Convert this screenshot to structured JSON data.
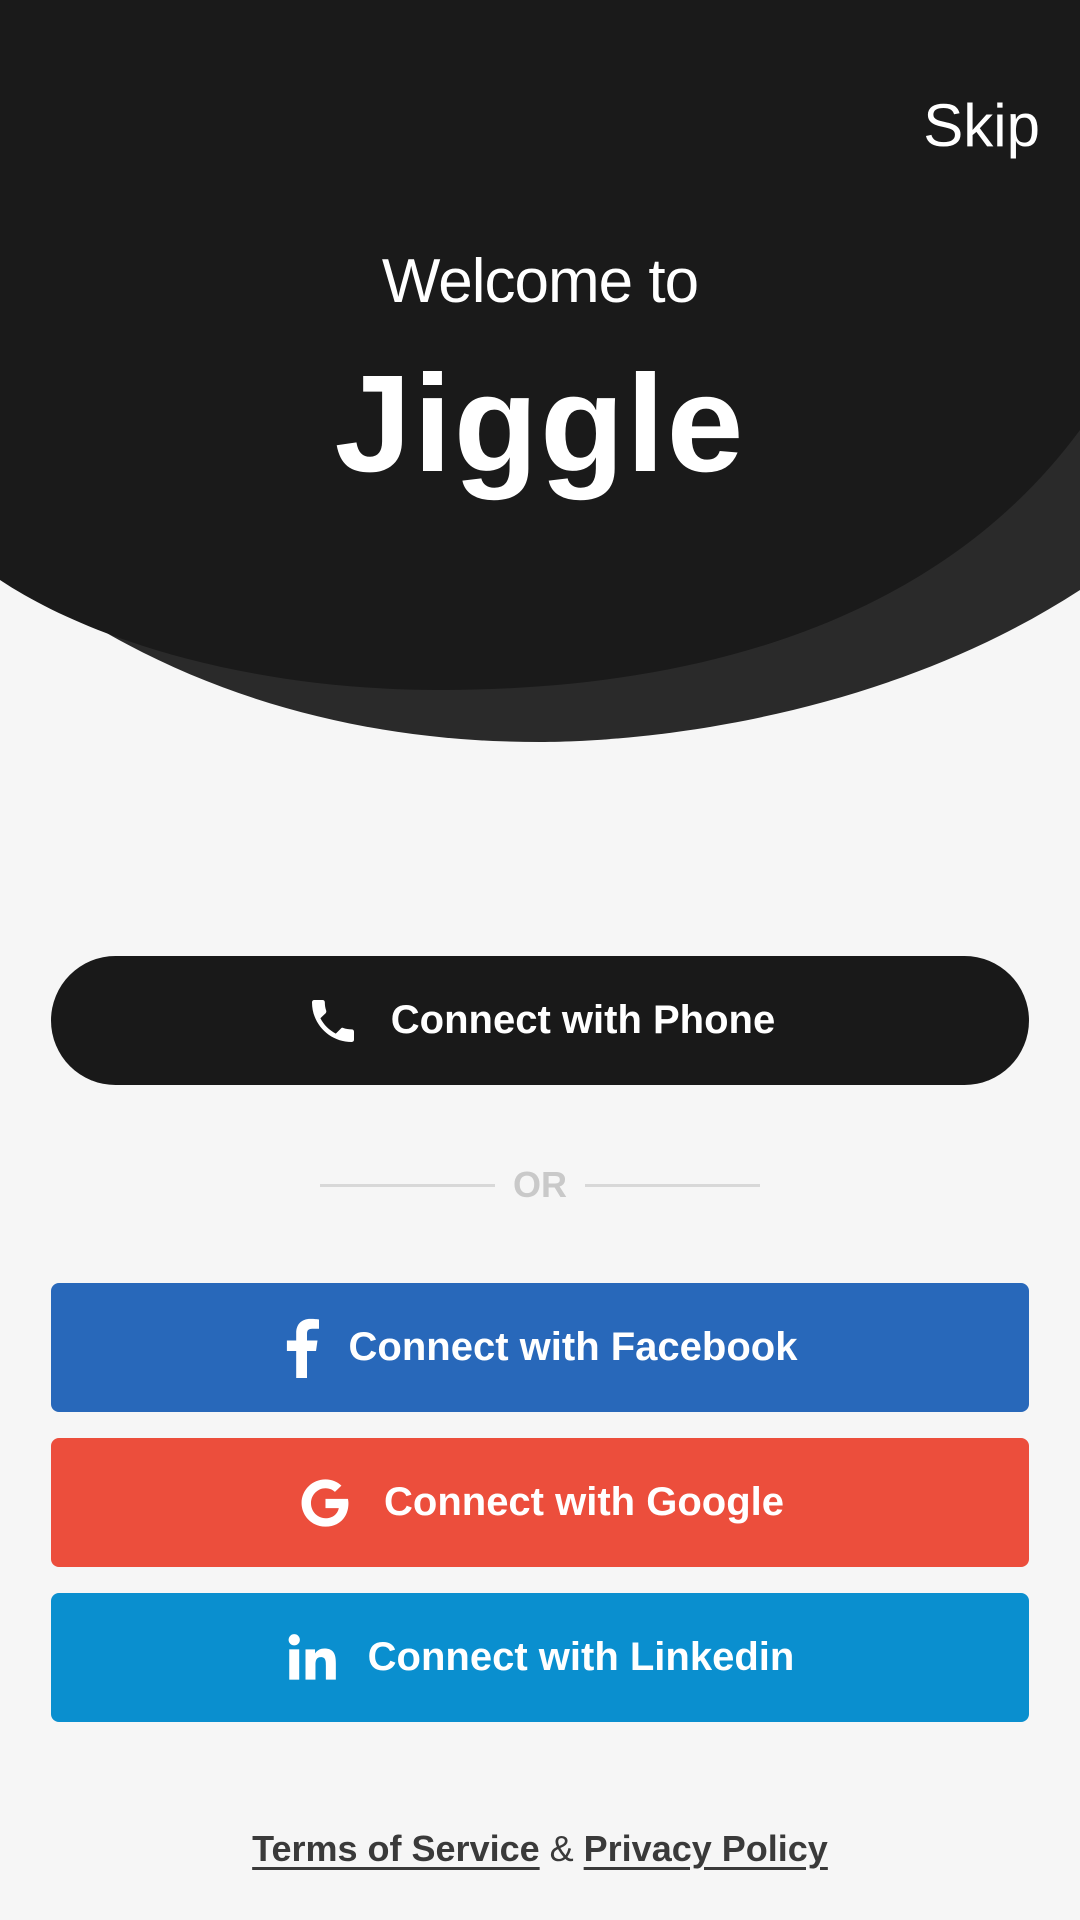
{
  "header": {
    "skip_label": "Skip",
    "welcome_text": "Welcome to",
    "brand_name": "Jiggle"
  },
  "buttons": {
    "phone": {
      "label": "Connect with Phone",
      "icon": "phone-icon",
      "color": "#191919"
    },
    "or_label": "OR",
    "facebook": {
      "label": "Connect with Facebook",
      "icon": "facebook-icon",
      "color": "#2868ba"
    },
    "google": {
      "label": "Connect with Google",
      "icon": "google-icon",
      "color": "#ec4e3c"
    },
    "linkedin": {
      "label": "Connect with Linkedin",
      "icon": "linkedin-icon",
      "color": "#0a8fcf"
    }
  },
  "footer": {
    "terms_label": "Terms of Service",
    "separator": "&",
    "privacy_label": "Privacy Policy"
  },
  "colors": {
    "hero_background": "#1a1a1a",
    "hero_accent": "#2a2a2a",
    "page_background": "#f6f6f6"
  }
}
